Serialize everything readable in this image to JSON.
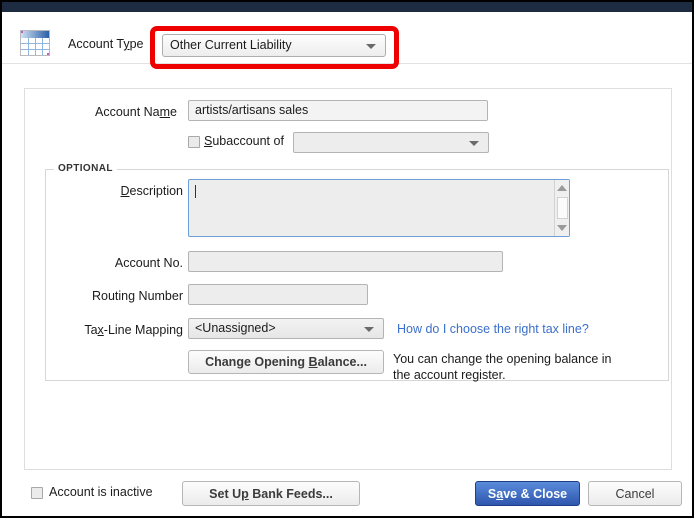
{
  "header": {
    "icon_name": "account-grid-icon",
    "account_type_label": "Account Type",
    "account_type_label_pre": "Account T",
    "account_type_label_mn": "y",
    "account_type_label_post": "pe",
    "account_type_value": "Other Current Liability",
    "highlight_color": "#ef0000"
  },
  "form": {
    "account_name_label_pre": "Account Na",
    "account_name_label_mn": "m",
    "account_name_label_post": "e",
    "account_name_value": "artists/artisans sales",
    "subaccount_label_mn": "S",
    "subaccount_label_post": "ubaccount of",
    "subaccount_checked": false,
    "subaccount_value": ""
  },
  "optional": {
    "legend": "OPTIONAL",
    "description_label_mn": "D",
    "description_label_post": "escription",
    "description_value": "",
    "account_no_label": "Account No.",
    "account_no_value": "",
    "routing_label": "Routing Number",
    "routing_value": "",
    "tax_line_label_pre": "Ta",
    "tax_line_label_mn": "x",
    "tax_line_label_post": "-Line Mapping",
    "tax_line_value": "<Unassigned>",
    "tax_help_link": "How do I choose the right tax line?",
    "tax_help_link_color": "#3a6fcc",
    "change_balance_pre": "Change Opening ",
    "change_balance_mn": "B",
    "change_balance_post": "alance...",
    "balance_note": "You can change the opening balance in the account register."
  },
  "footer": {
    "inactive_label": "Account is inactive",
    "inactive_checked": false,
    "bank_feeds_pre": "Set U",
    "bank_feeds_mn": "p",
    "bank_feeds_post": " Bank Feeds...",
    "save_pre": "S",
    "save_mn": "a",
    "save_post": "ve & Close",
    "save_color": "#2e56ad",
    "cancel_label": "Cancel"
  }
}
